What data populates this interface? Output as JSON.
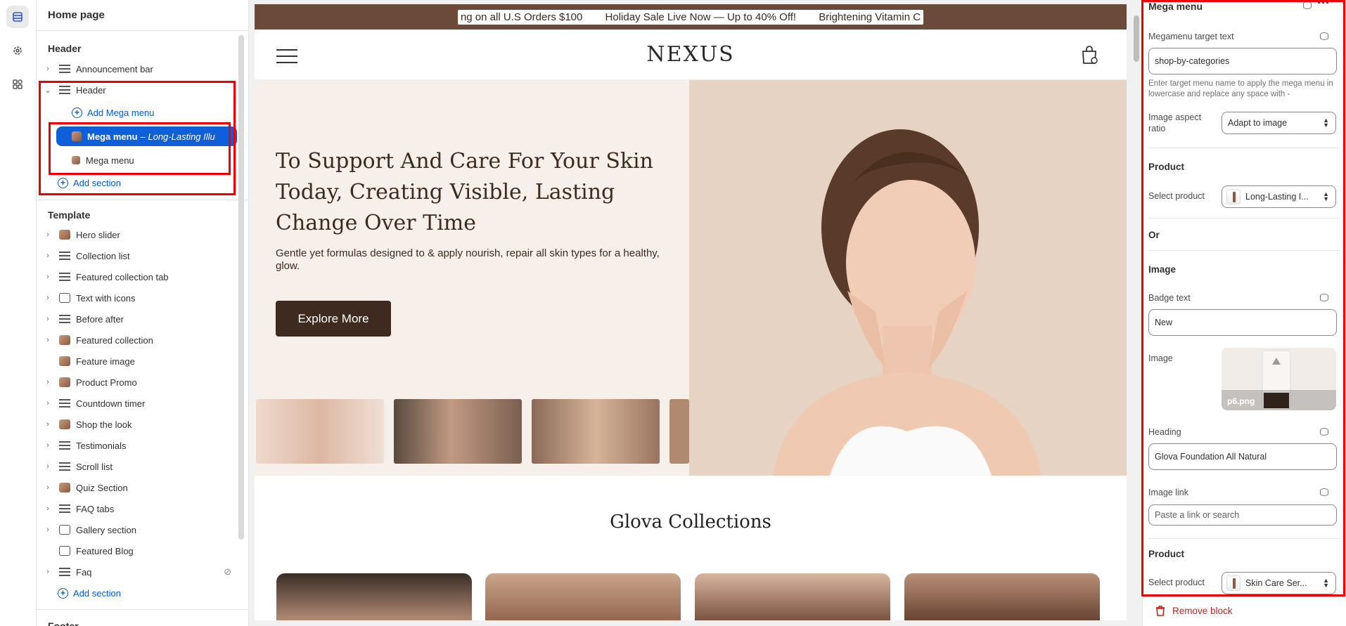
{
  "rail": {
    "items": [
      "sections-icon",
      "settings-icon",
      "apps-icon"
    ]
  },
  "sidebar": {
    "title": "Home page",
    "header_group": "Header",
    "header_items": [
      {
        "label": "Announcement bar",
        "icon": "section-icon"
      },
      {
        "label": "Header",
        "icon": "section-icon"
      }
    ],
    "add_mega_menu": "Add Mega menu",
    "mega_selected": {
      "label": "Mega menu",
      "suffix": "– Long-Lasting Illu"
    },
    "mega_second": "Mega menu",
    "add_section": "Add section",
    "template_group": "Template",
    "template_items": [
      "Hero slider",
      "Collection list",
      "Featured collection tab",
      "Text with icons",
      "Before after",
      "Featured collection",
      "Feature image",
      "Product Promo",
      "Countdown timer",
      "Shop the look",
      "Testimonials",
      "Scroll list",
      "Quiz Section",
      "FAQ tabs",
      "Gallery section",
      "Featured Blog",
      "Faq"
    ],
    "add_section_2": "Add section",
    "footer_group": "Footer"
  },
  "preview": {
    "announcement": [
      "ng on all U.S Orders $100",
      "Holiday Sale Live Now — Up to 40% Off!",
      "Brightening Vitamin C"
    ],
    "logo": "NEXUS",
    "hero_heading": "To Support And Care For Your Skin Today, Creating Visible, Lasting Change Over Time",
    "hero_text": "Gentle yet formulas designed to & apply nourish, repair all skin types for a healthy, glow.",
    "hero_button": "Explore More",
    "collections_title": "Glova Collections"
  },
  "panel": {
    "title": "Mega menu",
    "target_label": "Megamenu target text",
    "target_value": "shop-by-categories",
    "target_hint": "Enter target menu name to apply the mega menu in lowercase and replace any space with -",
    "aspect_label": "Image aspect ratio",
    "aspect_value": "Adapt to image",
    "product_head": "Product",
    "select_product_label": "Select product",
    "select_product_value": "Long-Lasting I...",
    "or_label": "Or",
    "image_head": "Image",
    "badge_label": "Badge text",
    "badge_value": "New",
    "image_label": "Image",
    "image_filename": "p6.png",
    "heading_label": "Heading",
    "heading_value": "Glova Foundation All Natural",
    "link_label": "Image link",
    "link_placeholder": "Paste a link or search",
    "product_head_2": "Product",
    "select_product_label_2": "Select product",
    "select_product_value_2": "Skin Care Ser...",
    "remove_label": "Remove block"
  },
  "colors": {
    "accent": "#0e5fd8",
    "highlight": "#e00000",
    "brand_brown": "#3f2a1f",
    "danger": "#c5241b"
  }
}
